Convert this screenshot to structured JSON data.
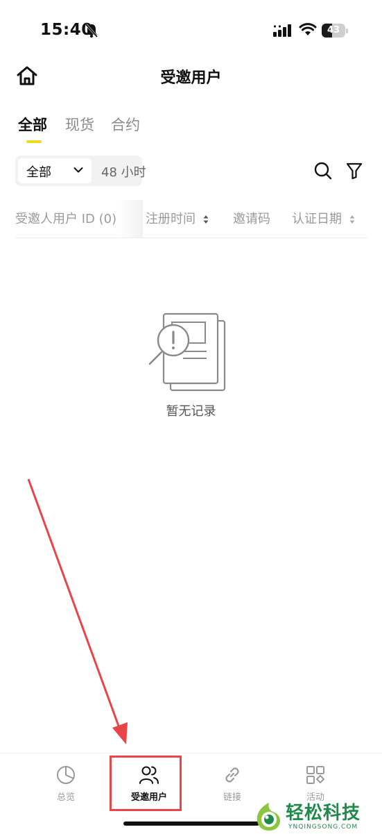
{
  "status_bar": {
    "time": "15:40",
    "battery": "43",
    "battery_level": 0.43
  },
  "header": {
    "title": "受邀用户"
  },
  "tabs": [
    {
      "label": "全部",
      "active": true
    },
    {
      "label": "现货",
      "active": false
    },
    {
      "label": "合约",
      "active": false
    }
  ],
  "filters": {
    "select_value": "全部",
    "hours": "48 小时"
  },
  "table": {
    "columns": [
      {
        "label": "受邀人用户 ID (0)"
      },
      {
        "label": "注册时间"
      },
      {
        "label": "邀请码"
      },
      {
        "label": "认证日期"
      }
    ]
  },
  "empty_state": {
    "text": "暂无记录"
  },
  "bottom_nav": [
    {
      "label": "总览",
      "icon": "pie-chart-icon",
      "active": false
    },
    {
      "label": "受邀用户",
      "icon": "users-icon",
      "active": true
    },
    {
      "label": "链接",
      "icon": "link-icon",
      "active": false
    },
    {
      "label": "活动",
      "icon": "apps-icon",
      "active": false
    }
  ],
  "watermark": {
    "title": "轻松科技",
    "subtitle": "YNQINGSONG.COM"
  },
  "colors": {
    "accent": "#f0dc1e",
    "annotation": "#e8444a",
    "watermark": "#1f8a4c"
  }
}
